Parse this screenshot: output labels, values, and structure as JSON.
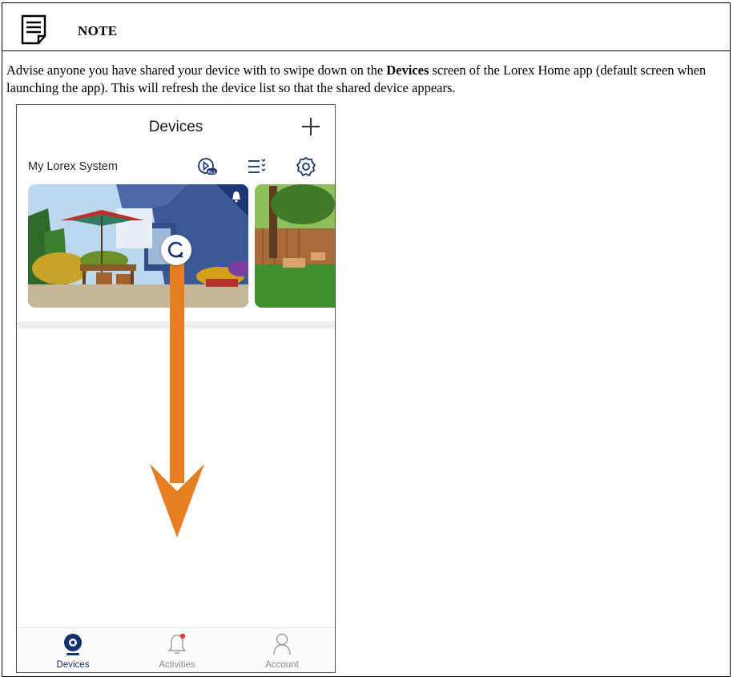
{
  "note": {
    "title": "NOTE",
    "text_before_bold": "Advise anyone you have shared your device with to swipe down on the ",
    "text_bold": "Devices",
    "text_after_bold": " screen of the Lorex Home app (default screen when launching the app). This will refresh the device list so that the shared device appears.",
    "icon": "note-document-icon"
  },
  "app": {
    "title": "Devices",
    "add_icon": "plus-icon",
    "section_label": "My Lorex System",
    "header_icons": [
      "play-all-icon",
      "list-filter-icon",
      "gear-icon"
    ],
    "cards": [
      {
        "name": "patio-camera",
        "icon": "bell-icon"
      },
      {
        "name": "backyard-camera"
      }
    ],
    "gesture": {
      "icon": "refresh-icon",
      "arrow_color": "#e67e22"
    },
    "tabs": [
      {
        "label": "Devices",
        "icon": "camera-icon",
        "active": true
      },
      {
        "label": "Activities",
        "icon": "bell-icon",
        "active": false
      },
      {
        "label": "Account",
        "icon": "person-icon",
        "active": false
      }
    ],
    "colors": {
      "brand": "#15316b",
      "notification_dot": "#e53935"
    }
  }
}
